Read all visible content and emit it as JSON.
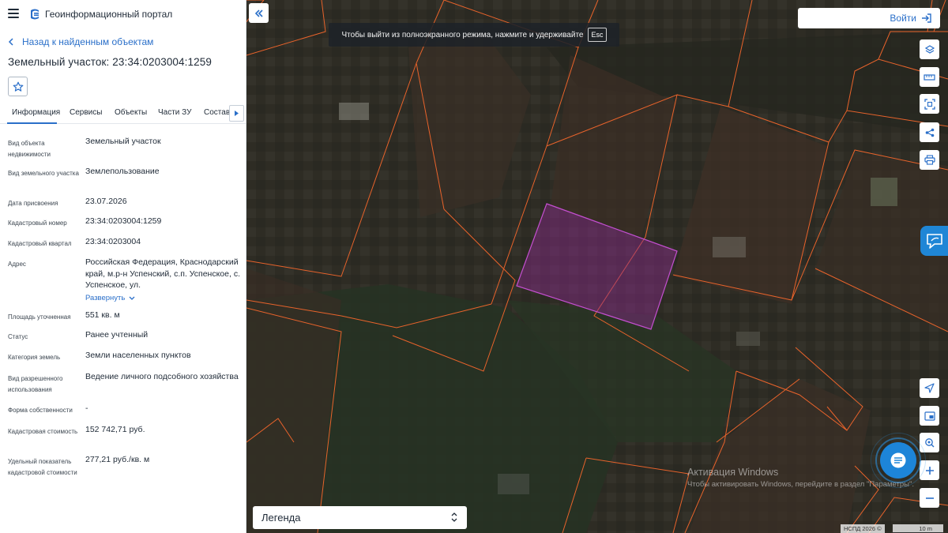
{
  "header": {
    "app_title": "Геоинформационный портал"
  },
  "nav": {
    "back_label": "Назад к найденным объектам"
  },
  "page": {
    "title": "Земельный участок: 23:34:0203004:1259"
  },
  "tabs": [
    {
      "label": "Информация",
      "active": true
    },
    {
      "label": "Сервисы",
      "active": false
    },
    {
      "label": "Объекты",
      "active": false
    },
    {
      "label": "Части ЗУ",
      "active": false
    },
    {
      "label": "Состав",
      "active": false
    }
  ],
  "attributes": [
    {
      "key": "Вид объекта недвижимости",
      "value": "Земельный участок"
    },
    {
      "key": "Вид земельного участка",
      "value": "Землепользование"
    },
    {
      "key": "Дата присвоения",
      "value": "23.07.2026"
    },
    {
      "key": "Кадастровый номер",
      "value": "23:34:0203004:1259"
    },
    {
      "key": "Кадастровый квартал",
      "value": "23:34:0203004"
    },
    {
      "key": "Адрес",
      "value": "Российская Федерация, Краснодарский край, м.р-н Успенский, с.п. Успенское, с. Успенское, ул.",
      "expand_label": "Развернуть"
    },
    {
      "key": "Площадь уточненная",
      "value": "551 кв. м"
    },
    {
      "key": "Статус",
      "value": "Ранее учтенный"
    },
    {
      "key": "Категория земель",
      "value": "Земли населенных пунктов"
    },
    {
      "key": "Вид разрешенного использования",
      "value": "Ведение личного подсобного хозяйства"
    },
    {
      "key": "Форма собственности",
      "value": "-"
    },
    {
      "key": "Кадастровая стоимость",
      "value": "152 742,71 руб."
    },
    {
      "key": "Удельный показатель кадастровой стоимости",
      "value": "277,21 руб./кв. м"
    }
  ],
  "map": {
    "fullscreen_hint": "Чтобы выйти из полноэкранного режима, нажмите и удерживайте",
    "fullscreen_key": "Esc",
    "login_label": "Войти",
    "legend_label": "Легенда",
    "watermark_title": "Активация Windows",
    "watermark_text": "Чтобы активировать Windows, перейдите в раздел \"Параметры\".",
    "copyright": "НСПД 2026 ©",
    "scale_label": "10 m",
    "icons": {
      "layers": "layers-icon",
      "ruler": "ruler-icon",
      "select_area": "select-area-icon",
      "share": "share-icon",
      "print": "print-icon",
      "locate": "locate-arrow-icon",
      "minimap": "minimap-icon",
      "geo_search": "geo-search-icon",
      "zoom_in": "zoom-in-icon",
      "zoom_out": "zoom-out-icon",
      "chat": "chat-icon"
    },
    "colors": {
      "parcel_line": "#e8632b",
      "selected_fill": "#8c2a8e",
      "selected_line": "#c44fd0",
      "accent": "#2a6fc9"
    }
  }
}
